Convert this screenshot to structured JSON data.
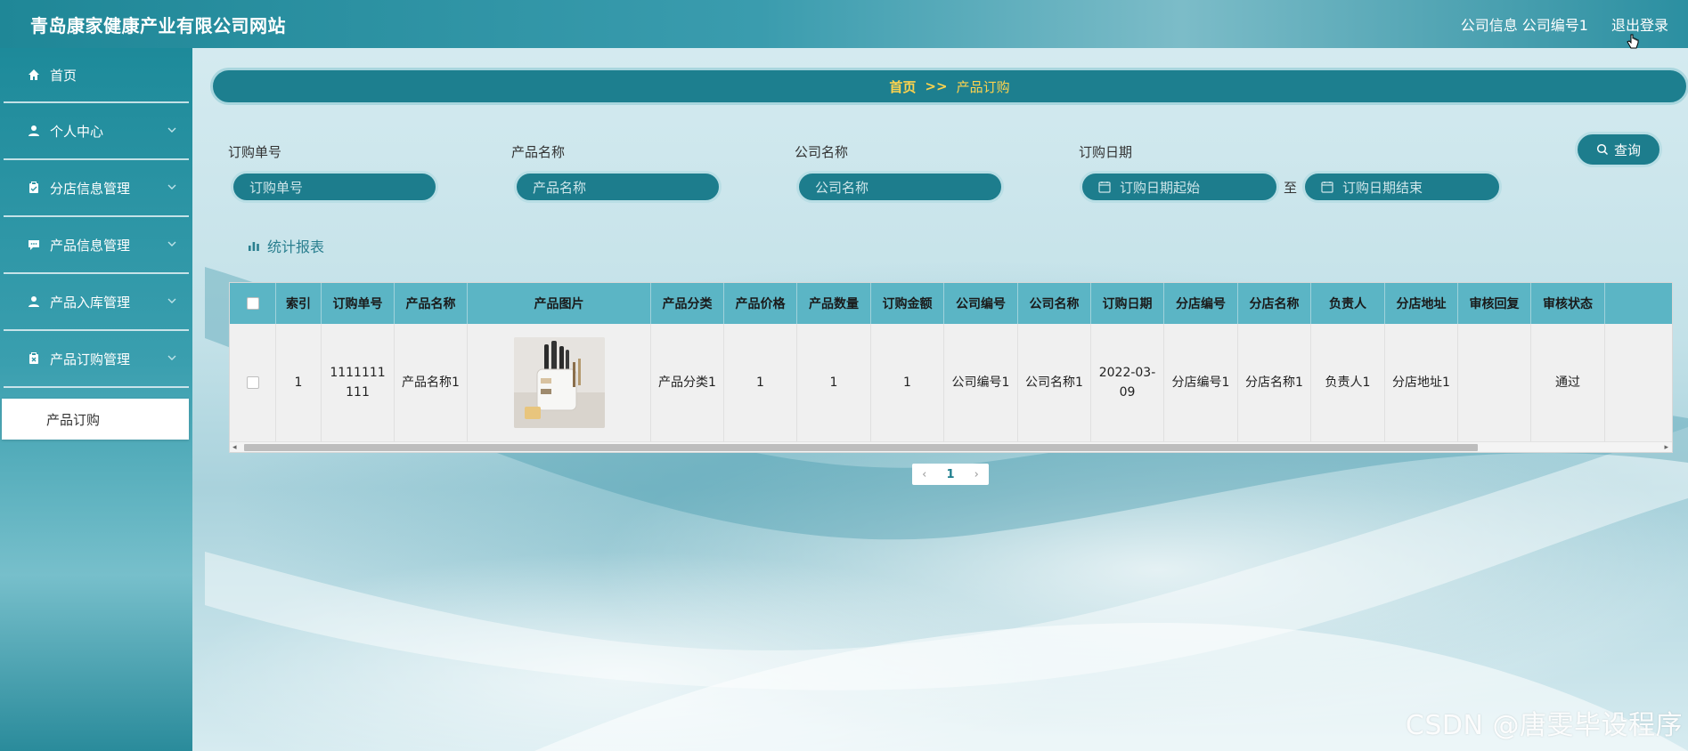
{
  "header": {
    "site_title": "青岛康家健康产业有限公司网站",
    "company_info": "公司信息 公司编号1",
    "logout": "退出登录"
  },
  "sidebar": {
    "items": [
      {
        "label": "首页",
        "icon": "home-icon"
      },
      {
        "label": "个人中心",
        "icon": "user-icon"
      },
      {
        "label": "分店信息管理",
        "icon": "clipboard-icon"
      },
      {
        "label": "产品信息管理",
        "icon": "chat-icon"
      },
      {
        "label": "产品入库管理",
        "icon": "user-icon"
      },
      {
        "label": "产品订购管理",
        "icon": "clipboard-x-icon"
      }
    ],
    "active_sub": "产品订购"
  },
  "breadcrumb": {
    "home": "首页",
    "separator": ">>",
    "current": "产品订购"
  },
  "search": {
    "order_no_label": "订购单号",
    "order_no_placeholder": "订购单号",
    "product_name_label": "产品名称",
    "product_name_placeholder": "产品名称",
    "company_name_label": "公司名称",
    "company_name_placeholder": "公司名称",
    "order_date_label": "订购日期",
    "date_start_placeholder": "订购日期起始",
    "date_to": "至",
    "date_end_placeholder": "订购日期结束",
    "query_button": "查询"
  },
  "report_link": "统计报表",
  "table": {
    "headers": [
      "索引",
      "订购单号",
      "产品名称",
      "产品图片",
      "产品分类",
      "产品价格",
      "产品数量",
      "订购金额",
      "公司编号",
      "公司名称",
      "订购日期",
      "分店编号",
      "分店名称",
      "负责人",
      "分店地址",
      "审核回复",
      "审核状态"
    ],
    "rows": [
      {
        "index": "1",
        "order_no": "1111111111",
        "product_name": "产品名称1",
        "product_category": "产品分类1",
        "price": "1",
        "quantity": "1",
        "amount": "1",
        "company_no": "公司编号1",
        "company_name": "公司名称1",
        "order_date": "2022-03-09",
        "branch_no": "分店编号1",
        "branch_name": "分店名称1",
        "manager": "负责人1",
        "branch_address": "分店地址1",
        "review_reply": "",
        "review_status": "通过"
      }
    ]
  },
  "pagination": {
    "prev": "‹",
    "current": "1",
    "next": "›"
  },
  "watermark": "CSDN @唐雯毕设程序",
  "colors": {
    "primary": "#1d7d8d",
    "header_accent": "#ffd34d",
    "table_header": "#5bb5c5"
  }
}
